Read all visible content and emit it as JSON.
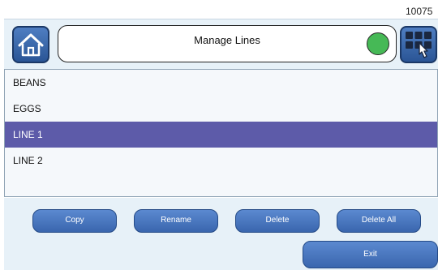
{
  "device_id": "10075",
  "header": {
    "title": "Manage Lines",
    "status_color": "#46b956"
  },
  "icons": {
    "home": "home-icon",
    "menu": "grid-touch-icon"
  },
  "lines": [
    {
      "label": "BEANS",
      "selected": false
    },
    {
      "label": "EGGS",
      "selected": false
    },
    {
      "label": "LINE 1",
      "selected": true
    },
    {
      "label": "LINE 2",
      "selected": false
    }
  ],
  "actions": {
    "copy": "Copy",
    "rename": "Rename",
    "delete": "Delete",
    "delete_all": "Delete All",
    "exit": "Exit"
  },
  "colors": {
    "selection": "#5d5ba9",
    "button": "#3f6cb4",
    "panel": "#e7f1f8"
  }
}
